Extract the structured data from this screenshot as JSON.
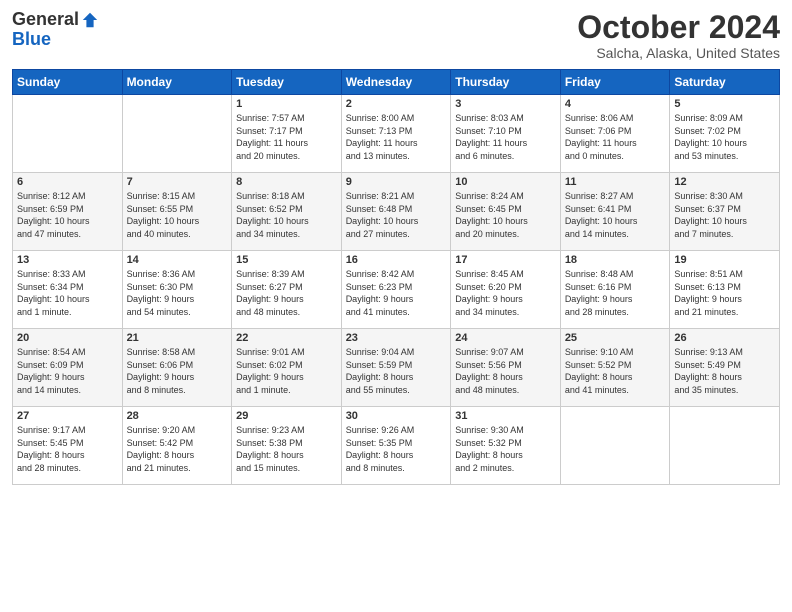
{
  "header": {
    "logo_general": "General",
    "logo_blue": "Blue",
    "month_title": "October 2024",
    "location": "Salcha, Alaska, United States"
  },
  "days_of_week": [
    "Sunday",
    "Monday",
    "Tuesday",
    "Wednesday",
    "Thursday",
    "Friday",
    "Saturday"
  ],
  "weeks": [
    [
      {
        "day": "",
        "info": ""
      },
      {
        "day": "",
        "info": ""
      },
      {
        "day": "1",
        "info": "Sunrise: 7:57 AM\nSunset: 7:17 PM\nDaylight: 11 hours\nand 20 minutes."
      },
      {
        "day": "2",
        "info": "Sunrise: 8:00 AM\nSunset: 7:13 PM\nDaylight: 11 hours\nand 13 minutes."
      },
      {
        "day": "3",
        "info": "Sunrise: 8:03 AM\nSunset: 7:10 PM\nDaylight: 11 hours\nand 6 minutes."
      },
      {
        "day": "4",
        "info": "Sunrise: 8:06 AM\nSunset: 7:06 PM\nDaylight: 11 hours\nand 0 minutes."
      },
      {
        "day": "5",
        "info": "Sunrise: 8:09 AM\nSunset: 7:02 PM\nDaylight: 10 hours\nand 53 minutes."
      }
    ],
    [
      {
        "day": "6",
        "info": "Sunrise: 8:12 AM\nSunset: 6:59 PM\nDaylight: 10 hours\nand 47 minutes."
      },
      {
        "day": "7",
        "info": "Sunrise: 8:15 AM\nSunset: 6:55 PM\nDaylight: 10 hours\nand 40 minutes."
      },
      {
        "day": "8",
        "info": "Sunrise: 8:18 AM\nSunset: 6:52 PM\nDaylight: 10 hours\nand 34 minutes."
      },
      {
        "day": "9",
        "info": "Sunrise: 8:21 AM\nSunset: 6:48 PM\nDaylight: 10 hours\nand 27 minutes."
      },
      {
        "day": "10",
        "info": "Sunrise: 8:24 AM\nSunset: 6:45 PM\nDaylight: 10 hours\nand 20 minutes."
      },
      {
        "day": "11",
        "info": "Sunrise: 8:27 AM\nSunset: 6:41 PM\nDaylight: 10 hours\nand 14 minutes."
      },
      {
        "day": "12",
        "info": "Sunrise: 8:30 AM\nSunset: 6:37 PM\nDaylight: 10 hours\nand 7 minutes."
      }
    ],
    [
      {
        "day": "13",
        "info": "Sunrise: 8:33 AM\nSunset: 6:34 PM\nDaylight: 10 hours\nand 1 minute."
      },
      {
        "day": "14",
        "info": "Sunrise: 8:36 AM\nSunset: 6:30 PM\nDaylight: 9 hours\nand 54 minutes."
      },
      {
        "day": "15",
        "info": "Sunrise: 8:39 AM\nSunset: 6:27 PM\nDaylight: 9 hours\nand 48 minutes."
      },
      {
        "day": "16",
        "info": "Sunrise: 8:42 AM\nSunset: 6:23 PM\nDaylight: 9 hours\nand 41 minutes."
      },
      {
        "day": "17",
        "info": "Sunrise: 8:45 AM\nSunset: 6:20 PM\nDaylight: 9 hours\nand 34 minutes."
      },
      {
        "day": "18",
        "info": "Sunrise: 8:48 AM\nSunset: 6:16 PM\nDaylight: 9 hours\nand 28 minutes."
      },
      {
        "day": "19",
        "info": "Sunrise: 8:51 AM\nSunset: 6:13 PM\nDaylight: 9 hours\nand 21 minutes."
      }
    ],
    [
      {
        "day": "20",
        "info": "Sunrise: 8:54 AM\nSunset: 6:09 PM\nDaylight: 9 hours\nand 14 minutes."
      },
      {
        "day": "21",
        "info": "Sunrise: 8:58 AM\nSunset: 6:06 PM\nDaylight: 9 hours\nand 8 minutes."
      },
      {
        "day": "22",
        "info": "Sunrise: 9:01 AM\nSunset: 6:02 PM\nDaylight: 9 hours\nand 1 minute."
      },
      {
        "day": "23",
        "info": "Sunrise: 9:04 AM\nSunset: 5:59 PM\nDaylight: 8 hours\nand 55 minutes."
      },
      {
        "day": "24",
        "info": "Sunrise: 9:07 AM\nSunset: 5:56 PM\nDaylight: 8 hours\nand 48 minutes."
      },
      {
        "day": "25",
        "info": "Sunrise: 9:10 AM\nSunset: 5:52 PM\nDaylight: 8 hours\nand 41 minutes."
      },
      {
        "day": "26",
        "info": "Sunrise: 9:13 AM\nSunset: 5:49 PM\nDaylight: 8 hours\nand 35 minutes."
      }
    ],
    [
      {
        "day": "27",
        "info": "Sunrise: 9:17 AM\nSunset: 5:45 PM\nDaylight: 8 hours\nand 28 minutes."
      },
      {
        "day": "28",
        "info": "Sunrise: 9:20 AM\nSunset: 5:42 PM\nDaylight: 8 hours\nand 21 minutes."
      },
      {
        "day": "29",
        "info": "Sunrise: 9:23 AM\nSunset: 5:38 PM\nDaylight: 8 hours\nand 15 minutes."
      },
      {
        "day": "30",
        "info": "Sunrise: 9:26 AM\nSunset: 5:35 PM\nDaylight: 8 hours\nand 8 minutes."
      },
      {
        "day": "31",
        "info": "Sunrise: 9:30 AM\nSunset: 5:32 PM\nDaylight: 8 hours\nand 2 minutes."
      },
      {
        "day": "",
        "info": ""
      },
      {
        "day": "",
        "info": ""
      }
    ]
  ]
}
